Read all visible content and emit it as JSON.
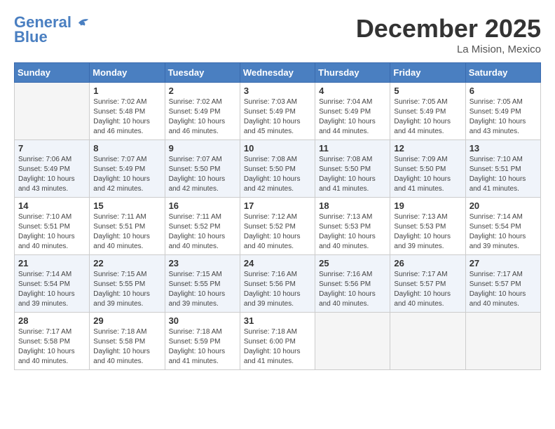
{
  "header": {
    "logo_line1": "General",
    "logo_line2": "Blue",
    "month": "December 2025",
    "location": "La Mision, Mexico"
  },
  "days_of_week": [
    "Sunday",
    "Monday",
    "Tuesday",
    "Wednesday",
    "Thursday",
    "Friday",
    "Saturday"
  ],
  "weeks": [
    [
      {
        "day": "",
        "info": ""
      },
      {
        "day": "1",
        "info": "Sunrise: 7:02 AM\nSunset: 5:48 PM\nDaylight: 10 hours\nand 46 minutes."
      },
      {
        "day": "2",
        "info": "Sunrise: 7:02 AM\nSunset: 5:49 PM\nDaylight: 10 hours\nand 46 minutes."
      },
      {
        "day": "3",
        "info": "Sunrise: 7:03 AM\nSunset: 5:49 PM\nDaylight: 10 hours\nand 45 minutes."
      },
      {
        "day": "4",
        "info": "Sunrise: 7:04 AM\nSunset: 5:49 PM\nDaylight: 10 hours\nand 44 minutes."
      },
      {
        "day": "5",
        "info": "Sunrise: 7:05 AM\nSunset: 5:49 PM\nDaylight: 10 hours\nand 44 minutes."
      },
      {
        "day": "6",
        "info": "Sunrise: 7:05 AM\nSunset: 5:49 PM\nDaylight: 10 hours\nand 43 minutes."
      }
    ],
    [
      {
        "day": "7",
        "info": "Sunrise: 7:06 AM\nSunset: 5:49 PM\nDaylight: 10 hours\nand 43 minutes."
      },
      {
        "day": "8",
        "info": "Sunrise: 7:07 AM\nSunset: 5:49 PM\nDaylight: 10 hours\nand 42 minutes."
      },
      {
        "day": "9",
        "info": "Sunrise: 7:07 AM\nSunset: 5:50 PM\nDaylight: 10 hours\nand 42 minutes."
      },
      {
        "day": "10",
        "info": "Sunrise: 7:08 AM\nSunset: 5:50 PM\nDaylight: 10 hours\nand 42 minutes."
      },
      {
        "day": "11",
        "info": "Sunrise: 7:08 AM\nSunset: 5:50 PM\nDaylight: 10 hours\nand 41 minutes."
      },
      {
        "day": "12",
        "info": "Sunrise: 7:09 AM\nSunset: 5:50 PM\nDaylight: 10 hours\nand 41 minutes."
      },
      {
        "day": "13",
        "info": "Sunrise: 7:10 AM\nSunset: 5:51 PM\nDaylight: 10 hours\nand 41 minutes."
      }
    ],
    [
      {
        "day": "14",
        "info": "Sunrise: 7:10 AM\nSunset: 5:51 PM\nDaylight: 10 hours\nand 40 minutes."
      },
      {
        "day": "15",
        "info": "Sunrise: 7:11 AM\nSunset: 5:51 PM\nDaylight: 10 hours\nand 40 minutes."
      },
      {
        "day": "16",
        "info": "Sunrise: 7:11 AM\nSunset: 5:52 PM\nDaylight: 10 hours\nand 40 minutes."
      },
      {
        "day": "17",
        "info": "Sunrise: 7:12 AM\nSunset: 5:52 PM\nDaylight: 10 hours\nand 40 minutes."
      },
      {
        "day": "18",
        "info": "Sunrise: 7:13 AM\nSunset: 5:53 PM\nDaylight: 10 hours\nand 40 minutes."
      },
      {
        "day": "19",
        "info": "Sunrise: 7:13 AM\nSunset: 5:53 PM\nDaylight: 10 hours\nand 39 minutes."
      },
      {
        "day": "20",
        "info": "Sunrise: 7:14 AM\nSunset: 5:54 PM\nDaylight: 10 hours\nand 39 minutes."
      }
    ],
    [
      {
        "day": "21",
        "info": "Sunrise: 7:14 AM\nSunset: 5:54 PM\nDaylight: 10 hours\nand 39 minutes."
      },
      {
        "day": "22",
        "info": "Sunrise: 7:15 AM\nSunset: 5:55 PM\nDaylight: 10 hours\nand 39 minutes."
      },
      {
        "day": "23",
        "info": "Sunrise: 7:15 AM\nSunset: 5:55 PM\nDaylight: 10 hours\nand 39 minutes."
      },
      {
        "day": "24",
        "info": "Sunrise: 7:16 AM\nSunset: 5:56 PM\nDaylight: 10 hours\nand 39 minutes."
      },
      {
        "day": "25",
        "info": "Sunrise: 7:16 AM\nSunset: 5:56 PM\nDaylight: 10 hours\nand 40 minutes."
      },
      {
        "day": "26",
        "info": "Sunrise: 7:17 AM\nSunset: 5:57 PM\nDaylight: 10 hours\nand 40 minutes."
      },
      {
        "day": "27",
        "info": "Sunrise: 7:17 AM\nSunset: 5:57 PM\nDaylight: 10 hours\nand 40 minutes."
      }
    ],
    [
      {
        "day": "28",
        "info": "Sunrise: 7:17 AM\nSunset: 5:58 PM\nDaylight: 10 hours\nand 40 minutes."
      },
      {
        "day": "29",
        "info": "Sunrise: 7:18 AM\nSunset: 5:58 PM\nDaylight: 10 hours\nand 40 minutes."
      },
      {
        "day": "30",
        "info": "Sunrise: 7:18 AM\nSunset: 5:59 PM\nDaylight: 10 hours\nand 41 minutes."
      },
      {
        "day": "31",
        "info": "Sunrise: 7:18 AM\nSunset: 6:00 PM\nDaylight: 10 hours\nand 41 minutes."
      },
      {
        "day": "",
        "info": ""
      },
      {
        "day": "",
        "info": ""
      },
      {
        "day": "",
        "info": ""
      }
    ]
  ]
}
